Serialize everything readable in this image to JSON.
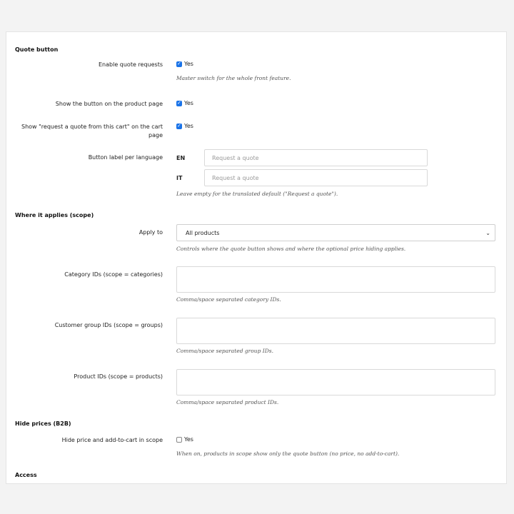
{
  "quote_button": {
    "heading": "Quote button",
    "enable": {
      "label": "Enable quote requests",
      "value": "Yes",
      "checked": true,
      "help": "Master switch for the whole front feature."
    },
    "show_product": {
      "label": "Show the button on the product page",
      "value": "Yes",
      "checked": true
    },
    "show_cart": {
      "label": "Show \"request a quote from this cart\" on the cart page",
      "value": "Yes",
      "checked": true
    },
    "button_label": {
      "label": "Button label per language",
      "en_code": "EN",
      "en_placeholder": "Request a quote",
      "it_code": "IT",
      "it_placeholder": "Request a quote",
      "help": "Leave empty for the translated default (\"Request a quote\")."
    }
  },
  "scope": {
    "heading": "Where it applies (scope)",
    "apply_to": {
      "label": "Apply to",
      "selected": "All products",
      "help": "Controls where the quote button shows and where the optional price hiding applies."
    },
    "category_ids": {
      "label": "Category IDs (scope = categories)",
      "help": "Comma/space separated category IDs."
    },
    "group_ids": {
      "label": "Customer group IDs (scope = groups)",
      "help": "Comma/space separated group IDs."
    },
    "product_ids": {
      "label": "Product IDs (scope = products)",
      "help": "Comma/space separated product IDs."
    }
  },
  "hide_prices": {
    "heading": "Hide prices (B2B)",
    "hide": {
      "label": "Hide price and add-to-cart in scope",
      "value": "Yes",
      "checked": false,
      "help": "When on, products in scope show only the quote button (no price, no add-to-cart)."
    }
  },
  "access": {
    "heading": "Access"
  },
  "colors": {
    "accent": "#1a73e8"
  }
}
